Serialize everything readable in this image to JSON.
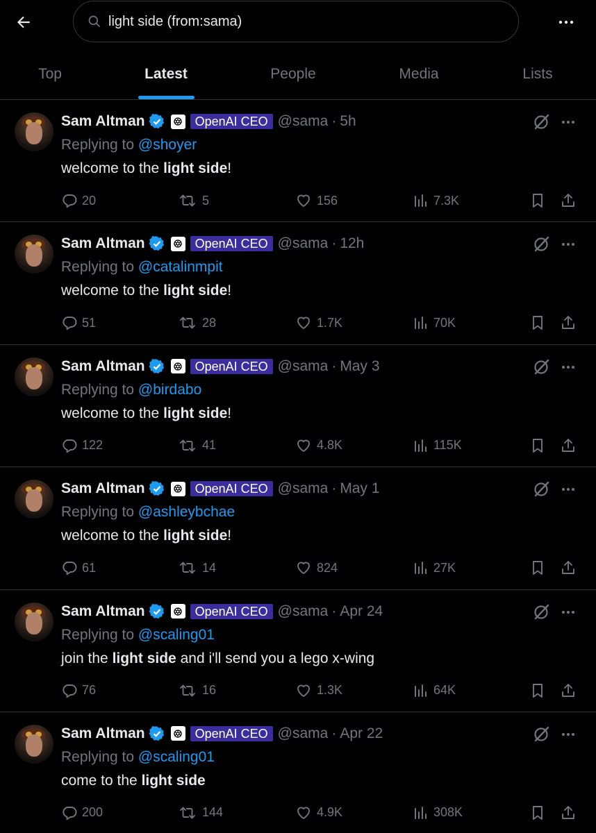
{
  "search": {
    "query": "light side (from:sama)"
  },
  "tabs": [
    {
      "label": "Top"
    },
    {
      "label": "Latest"
    },
    {
      "label": "People"
    },
    {
      "label": "Media"
    },
    {
      "label": "Lists"
    }
  ],
  "active_tab": "Latest",
  "colors": {
    "accent": "#1d9bf0",
    "badge_bg": "#3c2d9e",
    "muted": "#71767b",
    "text": "#e7e9ea",
    "background": "#000000"
  },
  "tweets": [
    {
      "name": "Sam Altman",
      "affiliation": "OpenAI CEO",
      "handle": "@sama",
      "sep": "·",
      "time": "5h",
      "replying_prefix": "Replying to",
      "replying_to": "@shoyer",
      "body": {
        "pre": "welcome to the",
        "bold": "light side",
        "post": "!"
      },
      "stats": {
        "replies": "20",
        "reposts": "5",
        "likes": "156",
        "views": "7.3K"
      }
    },
    {
      "name": "Sam Altman",
      "affiliation": "OpenAI CEO",
      "handle": "@sama",
      "sep": "·",
      "time": "12h",
      "replying_prefix": "Replying to",
      "replying_to": "@catalinmpit",
      "body": {
        "pre": "welcome to the",
        "bold": "light side",
        "post": "!"
      },
      "stats": {
        "replies": "51",
        "reposts": "28",
        "likes": "1.7K",
        "views": "70K"
      }
    },
    {
      "name": "Sam Altman",
      "affiliation": "OpenAI CEO",
      "handle": "@sama",
      "sep": "·",
      "time": "May 3",
      "replying_prefix": "Replying to",
      "replying_to": "@birdabo",
      "body": {
        "pre": "welcome to the",
        "bold": "light side",
        "post": "!"
      },
      "stats": {
        "replies": "122",
        "reposts": "41",
        "likes": "4.8K",
        "views": "115K"
      }
    },
    {
      "name": "Sam Altman",
      "affiliation": "OpenAI CEO",
      "handle": "@sama",
      "sep": "·",
      "time": "May 1",
      "replying_prefix": "Replying to",
      "replying_to": "@ashleybchae",
      "body": {
        "pre": "welcome to the",
        "bold": "light side",
        "post": "!"
      },
      "stats": {
        "replies": "61",
        "reposts": "14",
        "likes": "824",
        "views": "27K"
      }
    },
    {
      "name": "Sam Altman",
      "affiliation": "OpenAI CEO",
      "handle": "@sama",
      "sep": "·",
      "time": "Apr 24",
      "replying_prefix": "Replying to",
      "replying_to": "@scaling01",
      "body": {
        "pre": "join the",
        "bold": "light side",
        "post": "and i'll send you a lego x-wing"
      },
      "stats": {
        "replies": "76",
        "reposts": "16",
        "likes": "1.3K",
        "views": "64K"
      }
    },
    {
      "name": "Sam Altman",
      "affiliation": "OpenAI CEO",
      "handle": "@sama",
      "sep": "·",
      "time": "Apr 22",
      "replying_prefix": "Replying to",
      "replying_to": "@scaling01",
      "body": {
        "pre": "come to the",
        "bold": "light side",
        "post": ""
      },
      "stats": {
        "replies": "200",
        "reposts": "144",
        "likes": "4.9K",
        "views": "308K"
      }
    }
  ]
}
